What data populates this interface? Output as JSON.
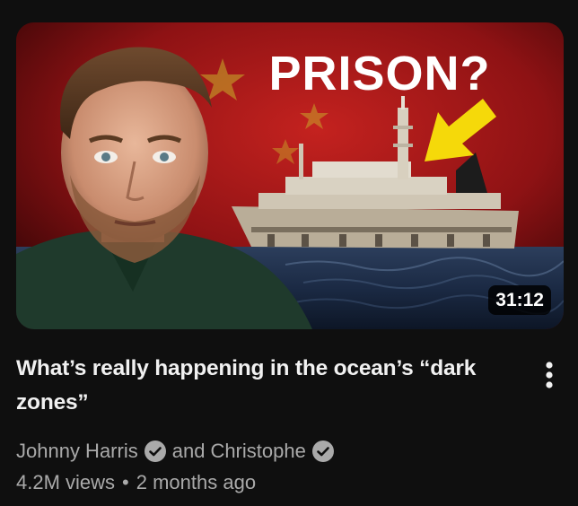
{
  "video": {
    "thumbnail_text": "PRISON?",
    "duration": "31:12",
    "title": "What’s really happening in the ocean’s “dark zones”",
    "channel_primary": "Johnny Harris",
    "channel_joiner": "and",
    "channel_secondary": "Christophe",
    "views": "4.2M views",
    "separator": "•",
    "age": "2 months ago"
  },
  "icons": {
    "verified": "check-circle-icon",
    "more": "vertical-ellipsis-icon",
    "arrow": "yellow-arrow-icon"
  },
  "colors": {
    "background": "#0f0f0f",
    "title_text": "#f1f1f1",
    "meta_text": "#aaaaaa",
    "arrow_yellow": "#f5d90a",
    "flag_red": "#b3191c"
  }
}
